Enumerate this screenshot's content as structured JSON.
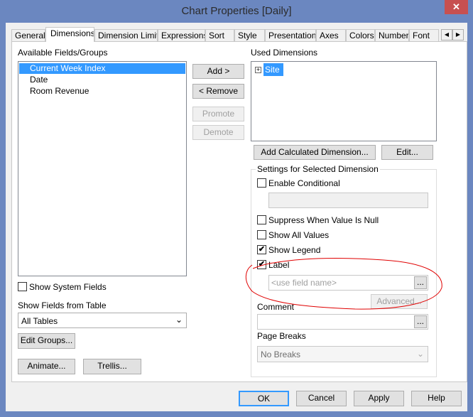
{
  "window": {
    "title": "Chart Properties [Daily]",
    "close": "✕"
  },
  "tabs": [
    "General",
    "Dimensions",
    "Dimension Limits",
    "Expressions",
    "Sort",
    "Style",
    "Presentation",
    "Axes",
    "Colors",
    "Number",
    "Font"
  ],
  "active_tab": "Dimensions",
  "available": {
    "label": "Available Fields/Groups",
    "items": [
      "Current Week Index",
      "Date",
      "Room Revenue"
    ],
    "selected": "Current Week Index"
  },
  "middle_buttons": {
    "add": "Add >",
    "remove": "< Remove",
    "promote": "Promote",
    "demote": "Demote"
  },
  "used": {
    "label": "Used Dimensions",
    "items": [
      "Site"
    ]
  },
  "add_calc": "Add Calculated Dimension...",
  "edit": "Edit...",
  "settings": {
    "title": "Settings for Selected Dimension",
    "enable_conditional": "Enable Conditional",
    "suppress_null": "Suppress When Value Is Null",
    "show_all": "Show All Values",
    "show_legend": "Show Legend",
    "label": "Label",
    "label_placeholder": "<use field name>",
    "browse": "...",
    "advanced": "Advanced...",
    "comment": "Comment",
    "page_breaks": "Page Breaks",
    "page_breaks_value": "No Breaks",
    "checked": {
      "enable_conditional": false,
      "suppress_null": false,
      "show_all": false,
      "show_legend": true,
      "label": true
    }
  },
  "left": {
    "show_system_fields": "Show System Fields",
    "show_fields_from": "Show Fields from Table",
    "table_value": "All Tables",
    "edit_groups": "Edit Groups...",
    "animate": "Animate...",
    "trellis": "Trellis..."
  },
  "footer": {
    "ok": "OK",
    "cancel": "Cancel",
    "apply": "Apply",
    "help": "Help"
  },
  "annotation_color": "#e00000"
}
